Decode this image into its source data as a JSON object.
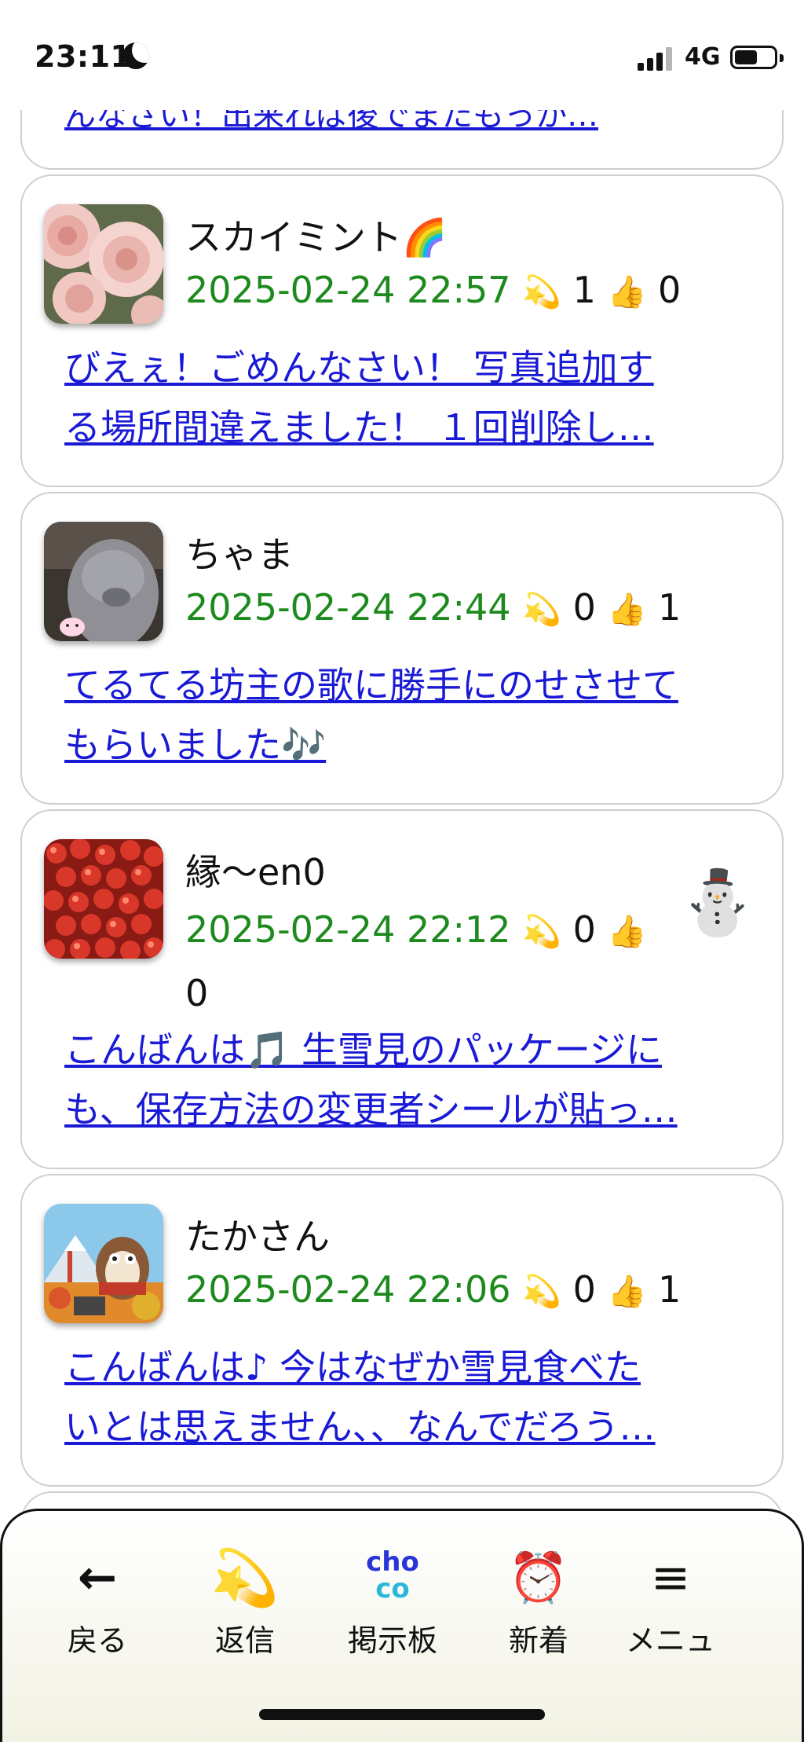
{
  "status": {
    "time": "23:11",
    "network": "4G"
  },
  "partial_post": {
    "snippet": "んなさい！出来れば後でまたもっか…"
  },
  "posts": [
    {
      "name": "スカイミント",
      "name_emoji": "🌈",
      "date": "2025-02-24 22:57",
      "reply_icon": "💫",
      "replies": "1",
      "like_icon": "👍",
      "likes": "0",
      "lines": [
        "びえぇ！ごめんなさい！ 写真追加す",
        "る場所間違えました！ １回削除し…"
      ],
      "stamp": ""
    },
    {
      "name": "ちゃま",
      "name_emoji": "",
      "date": "2025-02-24 22:44",
      "reply_icon": "💫",
      "replies": "0",
      "like_icon": "👍",
      "likes": "1",
      "lines": [
        "てるてる坊主の歌に勝手にのせさせて",
        "もらいました🎶"
      ],
      "stamp": ""
    },
    {
      "name": "縁〜en0",
      "name_emoji": "",
      "date": "2025-02-24 22:12",
      "reply_icon": "💫",
      "replies": "0",
      "like_icon": "👍",
      "likes": "0",
      "lines": [
        "こんばんは🎵 生雪見のパッケージに",
        "も、保存方法の変更者シールが貼っ…"
      ],
      "stamp": "⛄"
    },
    {
      "name": "たかさん",
      "name_emoji": "",
      "date": "2025-02-24 22:06",
      "reply_icon": "💫",
      "replies": "0",
      "like_icon": "👍",
      "likes": "1",
      "lines": [
        "こんばんは♪ 今はなぜか雪見食べた",
        "いとは思えません、、なんでだろう…"
      ],
      "stamp": ""
    }
  ],
  "nav": {
    "back": "戻る",
    "back_icon": "←",
    "reply": "返信",
    "reply_icon": "💫",
    "board": "掲示板",
    "board_logo_top": "cho",
    "board_logo_bottom": "co",
    "new": "新着",
    "new_icon": "⏰",
    "menu": "メニュ",
    "menu_icon": "≡"
  }
}
